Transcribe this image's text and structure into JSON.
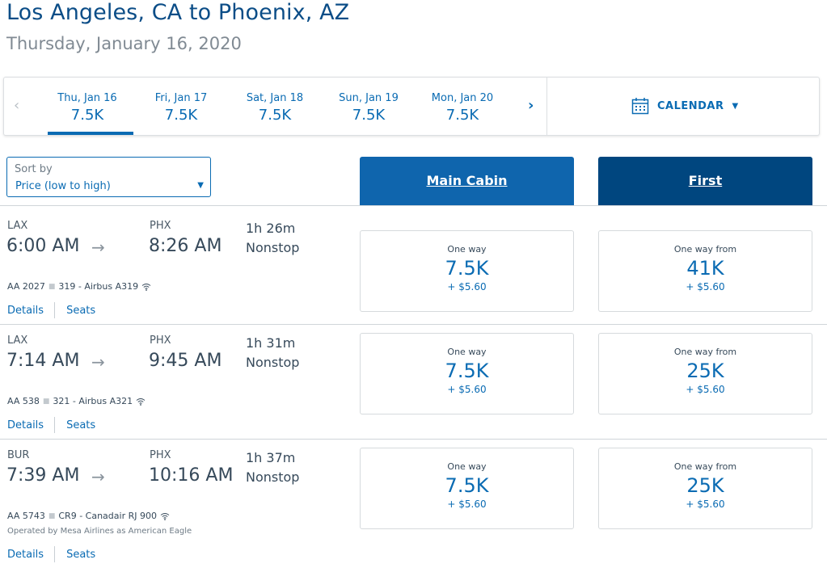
{
  "header": {
    "title": "Los Angeles, CA to Phoenix, AZ",
    "subtitle": "Thursday, January 16, 2020"
  },
  "date_strip": {
    "prev_icon": "chevron-left-icon",
    "next_icon": "chevron-right-icon",
    "days": [
      {
        "label": "Thu, Jan 16",
        "price": "7.5K",
        "selected": true
      },
      {
        "label": "Fri, Jan 17",
        "price": "7.5K",
        "selected": false
      },
      {
        "label": "Sat, Jan 18",
        "price": "7.5K",
        "selected": false
      },
      {
        "label": "Sun, Jan 19",
        "price": "7.5K",
        "selected": false
      },
      {
        "label": "Mon, Jan 20",
        "price": "7.5K",
        "selected": false
      }
    ],
    "calendar_label": "CALENDAR",
    "calendar_icon": "calendar-icon"
  },
  "sort": {
    "label": "Sort by",
    "value": "Price (low to high)"
  },
  "cabins": {
    "main": "Main Cabin",
    "first": "First"
  },
  "flights": [
    {
      "origin": "LAX",
      "depart": "6:00 AM",
      "dest": "PHX",
      "arrive": "8:26 AM",
      "duration": "1h 26m",
      "stops": "Nonstop",
      "flight_no": "AA 2027",
      "aircraft": "319 - Airbus A319",
      "operated_by": "",
      "links": {
        "details": "Details",
        "seats": "Seats"
      },
      "main": {
        "label": "One way",
        "miles": "7.5K",
        "tax": "+ $5.60"
      },
      "first": {
        "label": "One way from",
        "miles": "41K",
        "tax": "+ $5.60"
      }
    },
    {
      "origin": "LAX",
      "depart": "7:14 AM",
      "dest": "PHX",
      "arrive": "9:45 AM",
      "duration": "1h 31m",
      "stops": "Nonstop",
      "flight_no": "AA 538",
      "aircraft": "321 - Airbus A321",
      "operated_by": "",
      "links": {
        "details": "Details",
        "seats": "Seats"
      },
      "main": {
        "label": "One way",
        "miles": "7.5K",
        "tax": "+ $5.60"
      },
      "first": {
        "label": "One way from",
        "miles": "25K",
        "tax": "+ $5.60"
      }
    },
    {
      "origin": "BUR",
      "depart": "7:39 AM",
      "dest": "PHX",
      "arrive": "10:16 AM",
      "duration": "1h 37m",
      "stops": "Nonstop",
      "flight_no": "AA 5743",
      "aircraft": "CR9 - Canadair RJ 900",
      "operated_by": "Operated by Mesa Airlines as American Eagle",
      "links": {
        "details": "Details",
        "seats": "Seats"
      },
      "main": {
        "label": "One way",
        "miles": "7.5K",
        "tax": "+ $5.60"
      },
      "first": {
        "label": "One way from",
        "miles": "25K",
        "tax": "+ $5.60"
      }
    }
  ],
  "colors": {
    "brand_blue": "#0a6bb3",
    "main_cabin_bg": "#0f65ad",
    "first_cabin_bg": "#00467f",
    "title": "#0b4d87"
  }
}
